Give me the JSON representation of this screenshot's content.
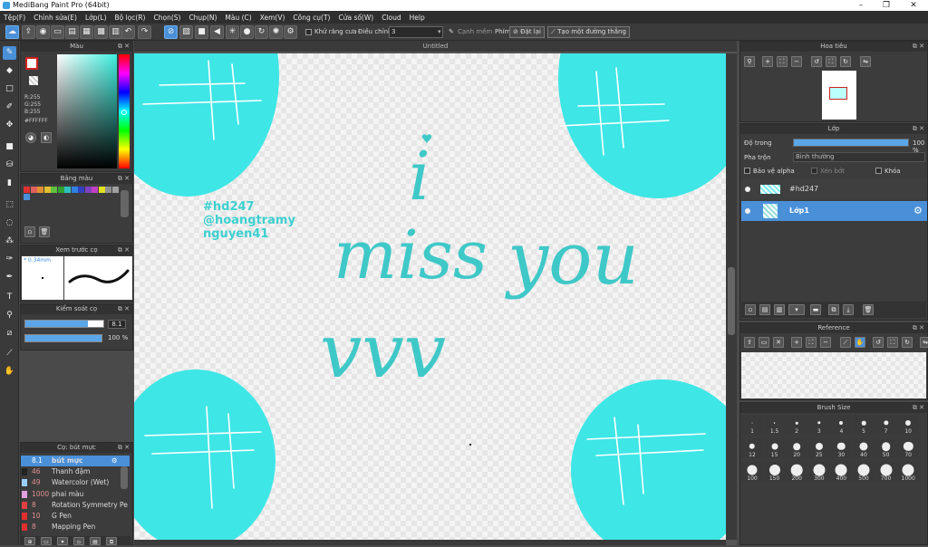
{
  "window": {
    "title": "MediBang Paint Pro (64bit)",
    "min": "–",
    "max": "❐",
    "close": "✕"
  },
  "menu": [
    "Tệp(F)",
    "Chỉnh sửa(E)",
    "Lớp(L)",
    "Bộ lọc(R)",
    "Chọn(S)",
    "Chụp(N)",
    "Màu (C)",
    "Xem(V)",
    "Công cụ(T)",
    "Cửa số(W)",
    "Cloud",
    "Help"
  ],
  "toolbar": {
    "antialias_label": "Khử răng cưa",
    "correction_label": "Điều chỉnh",
    "correction_value": "3",
    "sharp_label": "Cạnh mềm",
    "keys_label": "Phím",
    "reset_label": "Đặt lại",
    "straight_label": "Tạo một đường thẳng"
  },
  "color_panel": {
    "title": "Màu",
    "r": "R:255",
    "g": "G:255",
    "b": "B:255",
    "hex": "#FFFFFF"
  },
  "palette_panel": {
    "title": "Bảng màu",
    "swatches": [
      "#e03030",
      "#e06060",
      "#e09030",
      "#e0c030",
      "#60c040",
      "#30a030",
      "#30c0c0",
      "#3080e0",
      "#3040c0",
      "#8040c0",
      "#c040c0",
      "#e0e020",
      "#909090",
      "#a0a0a0",
      "#4a90d9"
    ]
  },
  "preview_panel": {
    "title": "Xem trước cọ",
    "size": "* 0.34mm"
  },
  "control_panel": {
    "title": "Kiểm soát cọ",
    "size_value": "8.1",
    "opacity_value": "100 %",
    "size_level": 0.8,
    "opacity_level": 1.0
  },
  "brush_panel": {
    "title": "Cọ: bút mực",
    "items": [
      {
        "size": "8.1",
        "name": "bút mực",
        "color": "#4a90d9",
        "selected": true
      },
      {
        "size": "46",
        "name": "Thanh đậm",
        "color": "#222222",
        "selected": false
      },
      {
        "size": "49",
        "name": "Watercolor (Wet)",
        "color": "#9ad0ff",
        "selected": false
      },
      {
        "size": "1000",
        "name": "phai màu",
        "color": "#e0a0e0",
        "selected": false
      },
      {
        "size": "8",
        "name": "Rotation Symmetry Pe",
        "color": "#e04040",
        "selected": false
      },
      {
        "size": "10",
        "name": "G Pen",
        "color": "#e03030",
        "selected": false
      },
      {
        "size": "8",
        "name": "Mapping Pen",
        "color": "#e03030",
        "selected": false
      }
    ]
  },
  "canvas": {
    "tab": "Untitled",
    "hashtags": [
      "#hd247",
      "@hoangtramy",
      "nguyen41"
    ],
    "script_i": "i",
    "script_miss": "miss",
    "script_you": "you",
    "script_vvv": "vvv",
    "color": "#3ee6e6"
  },
  "navigator_panel": {
    "title": "Hoa tiêu"
  },
  "layer_panel": {
    "title": "Lớp",
    "opacity_label": "Độ trong",
    "opacity_value": "100 %",
    "opacity_level": 1.0,
    "blend_label": "Pha trộn",
    "blend_value": "Bình thường",
    "protect_alpha": "Bảo vệ alpha",
    "clipping": "Xén bớt",
    "lock": "Khóa",
    "layers": [
      {
        "name": "#hd247",
        "selected": false
      },
      {
        "name": "Lớp1",
        "selected": true
      }
    ]
  },
  "reference_panel": {
    "title": "Reference"
  },
  "brush_size_panel": {
    "title": "Brush Size",
    "sizes": [
      "1",
      "1.5",
      "2",
      "3",
      "4",
      "5",
      "7",
      "10",
      "12",
      "15",
      "20",
      "25",
      "30",
      "40",
      "50",
      "70",
      "100",
      "150",
      "200",
      "300",
      "400",
      "500",
      "700",
      "1000"
    ]
  }
}
